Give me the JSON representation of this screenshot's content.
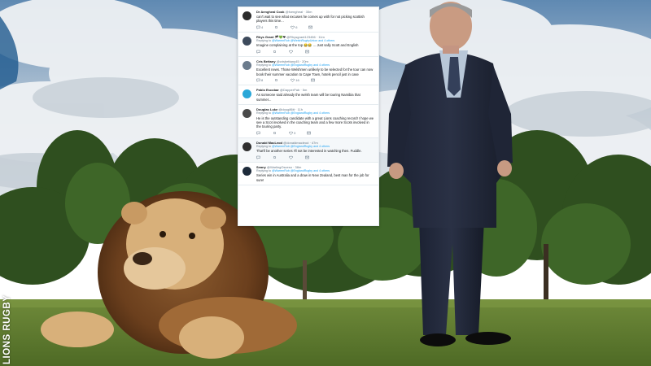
{
  "tweets": [
    {
      "name": "Dr Aengheal Cook",
      "handle": "@fcengheal",
      "time": "35m",
      "reply_to": "",
      "text": "can't wait to see what excuses he comes up with for not picking scottish players this time...",
      "avatar_color": "#2b2b2b",
      "replies": "4",
      "retweets": "",
      "likes": "6"
    },
    {
      "name": "Rhys Grant 🏴💚❤",
      "handle": "@Rhysgrant123456",
      "time": "11m",
      "reply_to": "@WarrenRob @WelshRugbyUnion and 4 others",
      "text": "Imagine complaining at the top 😂😂 ... Just sally Scott and English",
      "avatar_color": "#3d4a5c",
      "replies": "",
      "retweets": "",
      "likes": ""
    },
    {
      "name": "Cris Bettany",
      "handle": "@crisbettany45",
      "time": "20m",
      "reply_to": "@WarrenRob @EnglandRugby and 4 others",
      "text": "Excellent news. Those Welshmen unlikely to be selected for the tour can now book their summer vacation to Cape Town, hotels pencil just in case",
      "avatar_color": "#6b7b8c",
      "replies": "8",
      "retweets": "",
      "likes": "16"
    },
    {
      "name": "Pablo Escobar",
      "handle": "@DapperPab",
      "time": "5m",
      "reply_to": "",
      "text": "As someone said already the welsh team will be touring Namibia that summer...",
      "avatar_color": "#2aa7d8",
      "replies": "",
      "retweets": "",
      "likes": ""
    },
    {
      "name": "Douglas Luke",
      "handle": "@doug86tt",
      "time": "11h",
      "reply_to": "@WarrenRob @EnglandRugby and 4 others",
      "text": "He is the outstanding candidate with a great Lions coaching record! I hope we see a Scot involved in the coaching team and a few more Scots involved in the touring party.",
      "avatar_color": "#4a4a4a",
      "replies": "",
      "retweets": "",
      "likes": "3"
    },
    {
      "name": "Donald MacLeod",
      "handle": "@donaldmacleod",
      "time": "47m",
      "reply_to": "@WarrenRob @EnglandRugby and 4 others",
      "text": "That'll be another series I'll not be interested in watching then. Fuddle.",
      "avatar_color": "#2f2f2f",
      "replies": "",
      "retweets": "",
      "likes": ""
    },
    {
      "name": "Seany",
      "handle": "@WarlingOsceso",
      "time": "38m",
      "reply_to": "@WarrenRob @EnglandRugby and 4 others",
      "text": "Series win in Australia and a draw in New Zealand, best man for the job for sure!",
      "avatar_color": "#1d2a3a",
      "replies": "",
      "retweets": "",
      "likes": ""
    }
  ],
  "watermark": "LIONS RUGBY",
  "reply_prefix": "Replying to"
}
